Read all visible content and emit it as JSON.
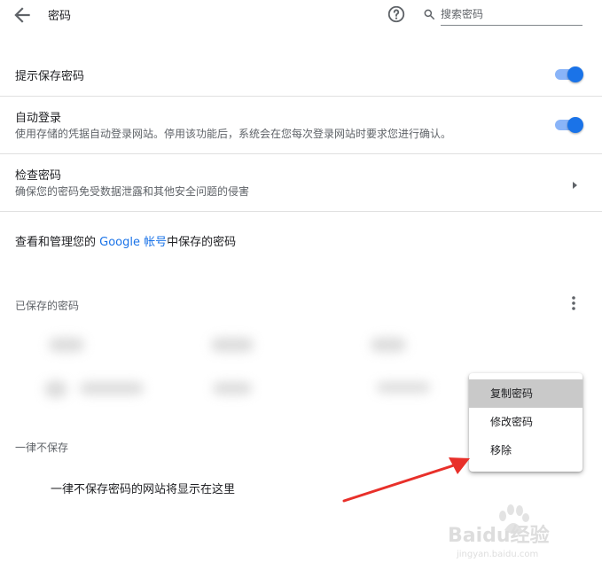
{
  "header": {
    "title": "密码",
    "search_placeholder": "搜索密码"
  },
  "offer_to_save": {
    "label": "提示保存密码",
    "enabled": true
  },
  "auto_signin": {
    "label": "自动登录",
    "description": "使用存储的凭据自动登录网站。停用该功能后，系统会在您每次登录网站时要求您进行确认。",
    "enabled": true
  },
  "check_passwords": {
    "label": "检查密码",
    "description": "确保您的密码免受数据泄露和其他安全问题的侵害"
  },
  "manage_account": {
    "prefix": "查看和管理您的 ",
    "link": "Google 帐号",
    "suffix": "中保存的密码"
  },
  "saved_passwords": {
    "title": "已保存的密码"
  },
  "context_menu": {
    "items": [
      {
        "label": "复制密码",
        "highlighted": true
      },
      {
        "label": "修改密码",
        "highlighted": false
      },
      {
        "label": "移除",
        "highlighted": false
      }
    ]
  },
  "never_saved": {
    "title": "一律不保存",
    "empty_text": "一律不保存密码的网站将显示在这里"
  },
  "watermark": {
    "text": "Baidu经验",
    "url": "jingyan.baidu.com"
  },
  "colors": {
    "accent": "#1a73e8",
    "toggle_track": "#8ab4f8",
    "arrow": "#e8302a"
  }
}
